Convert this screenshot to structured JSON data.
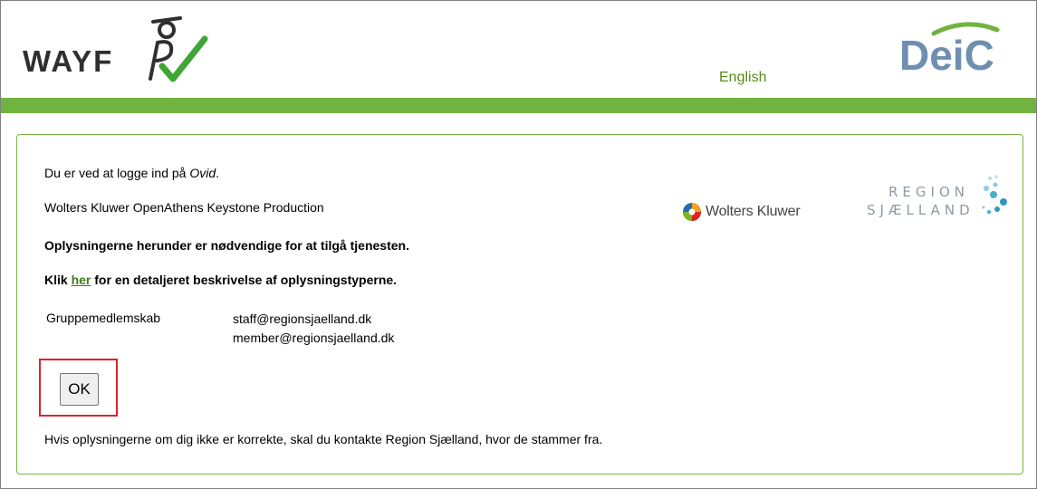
{
  "header": {
    "wayf_logo_text": "WAYF",
    "deic_logo_text": "DeiC",
    "language_link": "English",
    "colors": {
      "green": "#71b340",
      "deic_blue": "#6f8fb1",
      "check_green": "#3fa535"
    }
  },
  "notice": {
    "intro_prefix": "Du er ved at logge ind på ",
    "intro_service": "Ovid",
    "intro_suffix": ".",
    "service_provider": "Wolters Kluwer OpenAthens Keystone Production",
    "required_info": "Oplysningerne herunder er nødvendige for at tilgå tjenesten.",
    "details_prefix": "Klik ",
    "details_link": "her",
    "details_suffix": " for en detaljeret beskrivelse af oplysningstyperne.",
    "footer_text": "Hvis oplysningerne om dig ikke er korrekte, skal du kontakte Region Sjælland, hvor de stammer fra."
  },
  "attributes": [
    {
      "name": "Gruppemedlemskab",
      "values": [
        "staff@regionsjaelland.dk",
        "member@regionsjaelland.dk"
      ]
    }
  ],
  "ok_button": {
    "label": "OK"
  },
  "logos": {
    "sp_logo_text": "Wolters Kluwer",
    "idp_logo_line1": "REGION",
    "idp_logo_line2": "SJÆLLAND"
  }
}
